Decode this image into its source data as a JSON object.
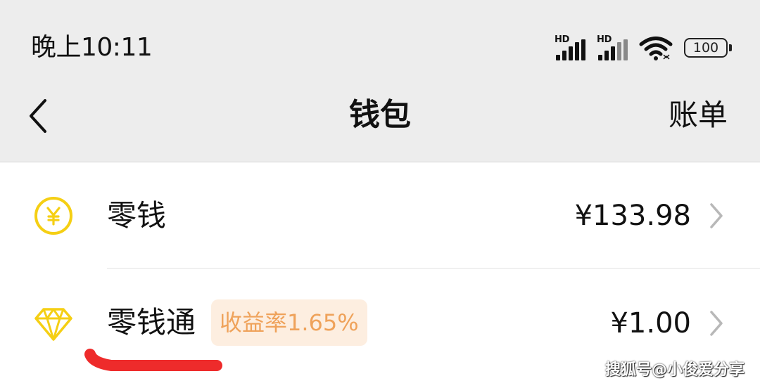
{
  "status_bar": {
    "time": "晚上10:11",
    "signal_1": {
      "label": "HD",
      "icon": "cell-signal-icon"
    },
    "signal_2": {
      "label": "HD",
      "icon": "cell-signal-icon"
    },
    "wifi_icon": "wifi-icon",
    "battery": "100"
  },
  "nav": {
    "back_icon": "chevron-left-icon",
    "title": "钱包",
    "bill": "账单"
  },
  "rows": [
    {
      "icon": "yuan-coin-icon",
      "label": "零钱",
      "value": "¥133.98",
      "chevron_icon": "chevron-right-icon"
    },
    {
      "icon": "diamond-icon",
      "label": "零钱通",
      "badge": "收益率1.65%",
      "value": "¥1.00",
      "chevron_icon": "chevron-right-icon"
    }
  ],
  "watermark": "搜狐号@小俊爱分享",
  "colors": {
    "header_bg": "#ededed",
    "icon_yellow": "#f5cf14",
    "badge_bg": "#fdeee0",
    "badge_text": "#efa25a",
    "annotation_red": "#ee2b2b"
  }
}
